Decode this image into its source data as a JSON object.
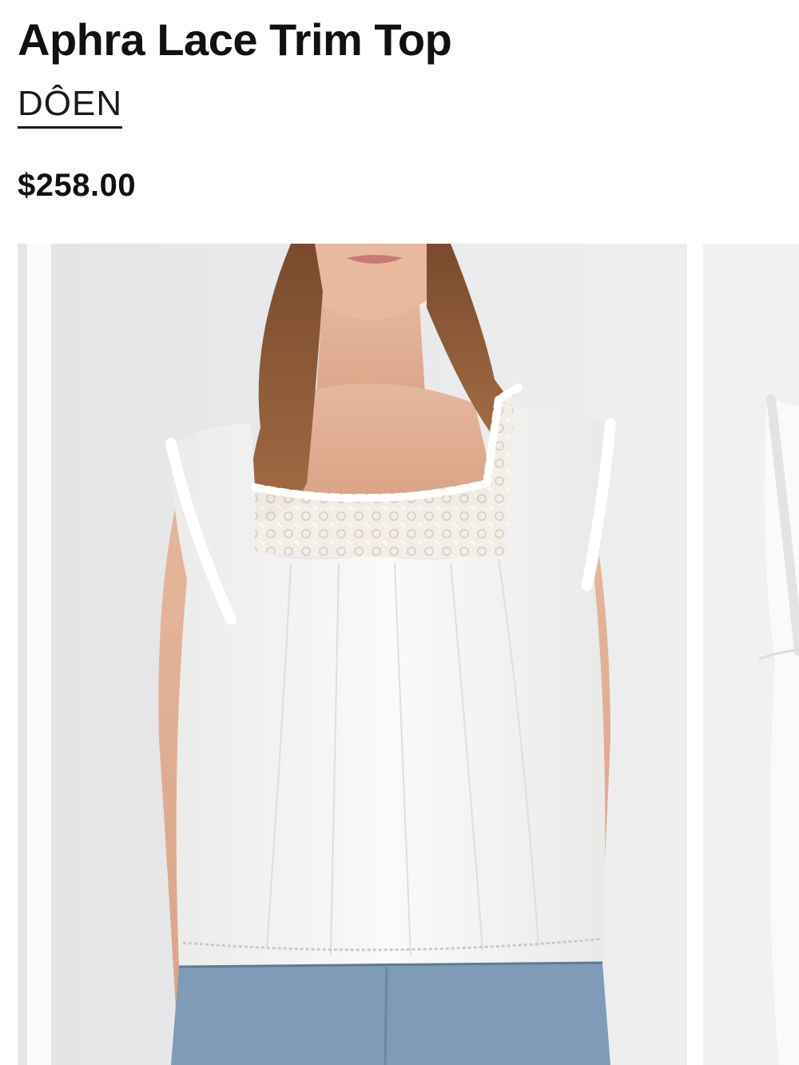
{
  "product": {
    "title": "Aphra Lace Trim Top",
    "brand": "DÔEN",
    "price": "$258.00"
  },
  "gallery": {
    "active_image": "model wearing white square-neck lace trim top with blue jeans",
    "next_image": "partial view of the same white top"
  },
  "colors": {
    "text": "#111111",
    "photo_background": "#e9e9ea",
    "garment": "#f8f8f6",
    "denim": "#7f9bb8"
  }
}
